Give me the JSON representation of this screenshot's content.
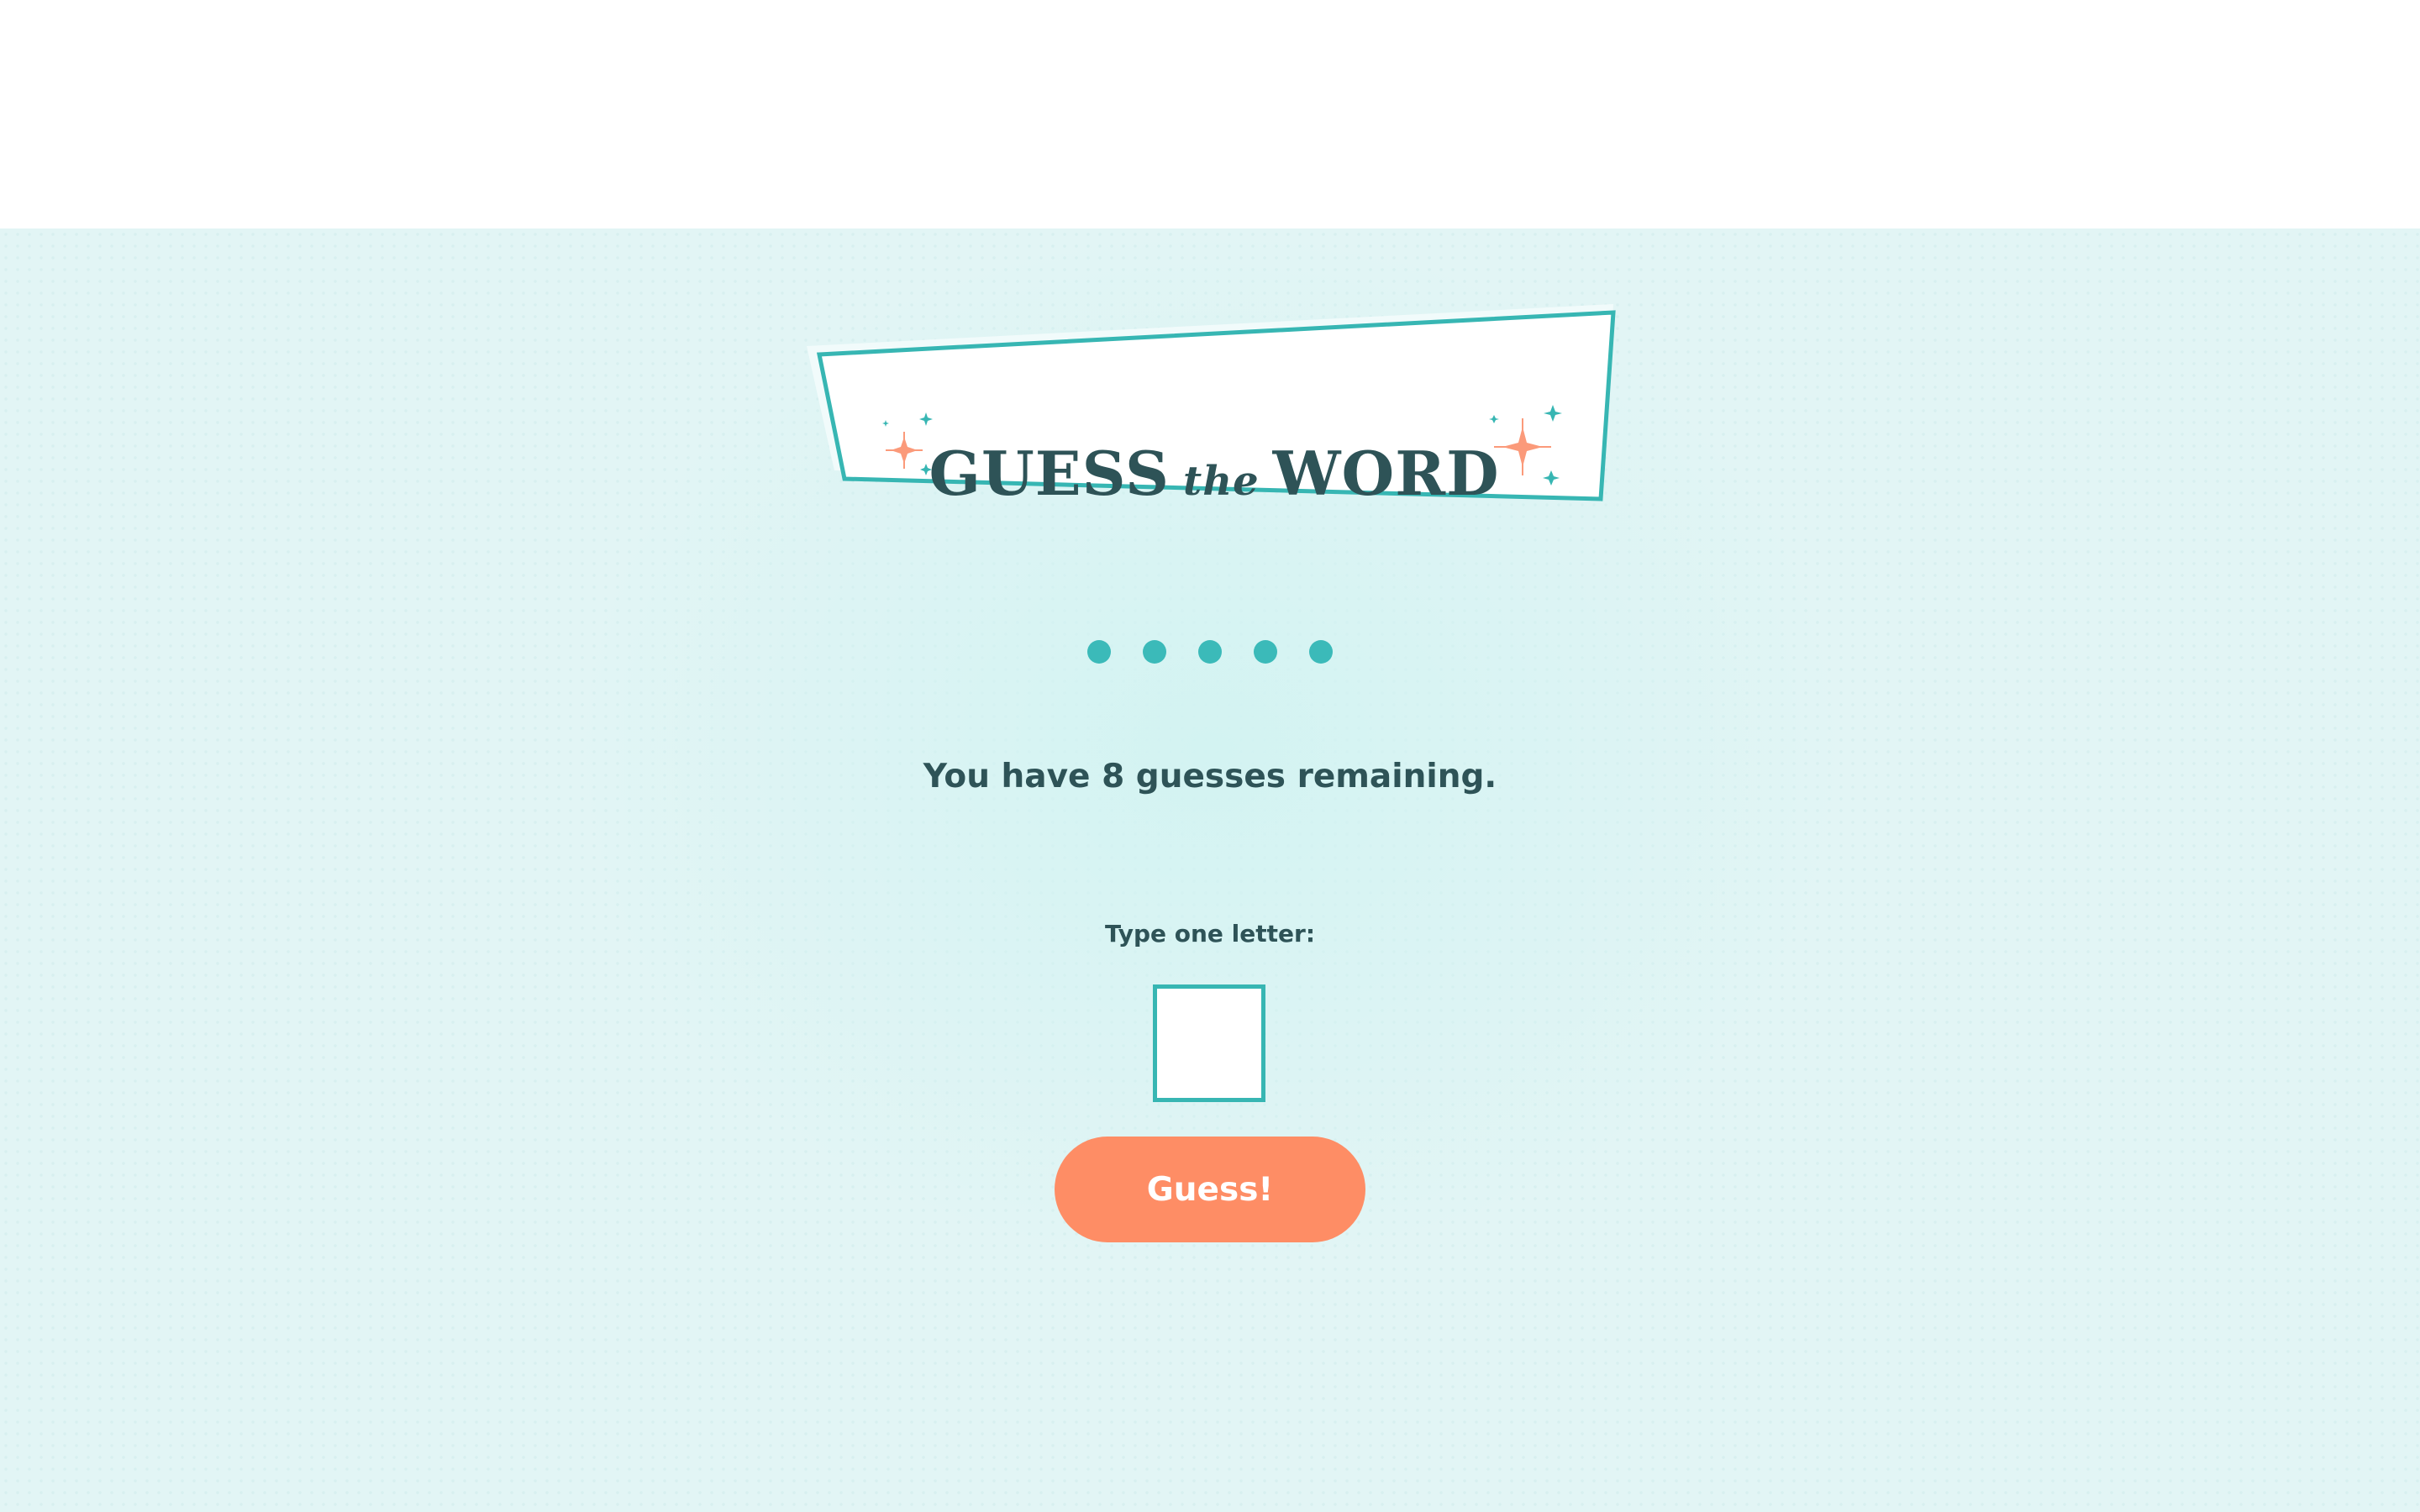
{
  "game": {
    "title_main_left": "GUESS",
    "title_the": "the",
    "title_main_right": "WORD",
    "word_placeholders": [
      "●",
      "●",
      "●",
      "●",
      "●"
    ],
    "remaining_message": "You have 8 guesses remaining.",
    "input_label": "Type one letter:",
    "letter_input_value": "",
    "guess_button_label": "Guess!"
  },
  "colors": {
    "teal": "#37b6b3",
    "dark_text": "#2e5357",
    "button": "#fe8d65",
    "background": "#e2f5f5"
  },
  "icons": [
    "sparkle-icon-left",
    "sparkle-icon-right"
  ]
}
